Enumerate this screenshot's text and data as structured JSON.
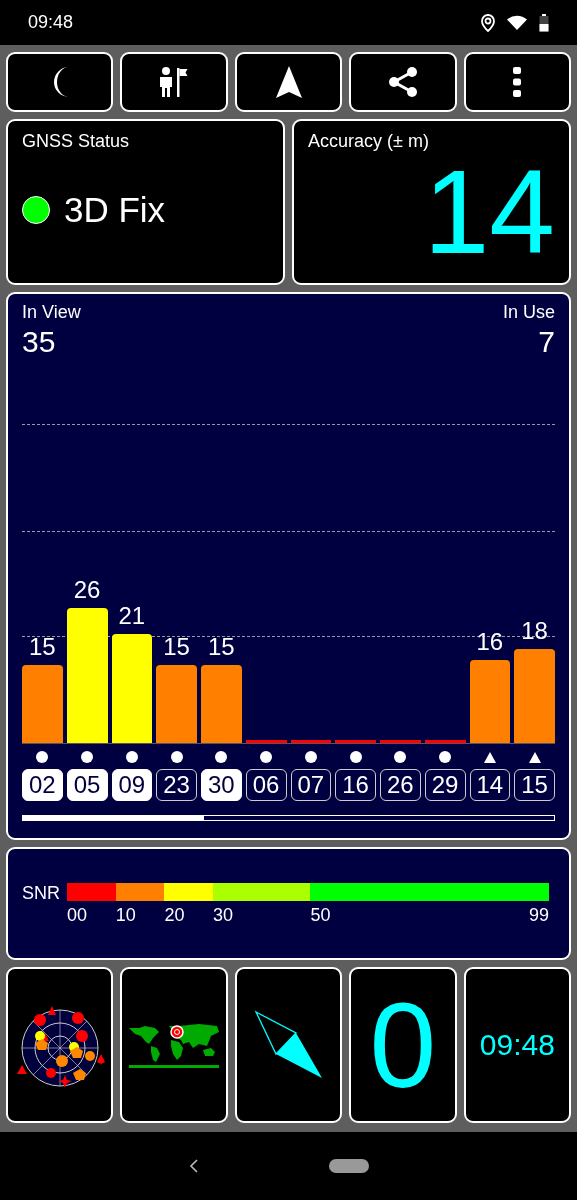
{
  "status_bar": {
    "time": "09:48"
  },
  "status_card": {
    "title": "GNSS Status",
    "fix": "3D Fix",
    "color": "#00ff00"
  },
  "accuracy_card": {
    "title": "Accuracy (± m)",
    "value": "14"
  },
  "satellites_panel": {
    "in_view_label": "In View",
    "in_view": "35",
    "in_use_label": "In Use",
    "in_use": "7",
    "satellites": [
      {
        "id": "02",
        "snr": "15",
        "color": "#ff8000",
        "in_use": true,
        "kind": "circle"
      },
      {
        "id": "05",
        "snr": "26",
        "color": "#ffff00",
        "in_use": true,
        "kind": "circle"
      },
      {
        "id": "09",
        "snr": "21",
        "color": "#ffff00",
        "in_use": true,
        "kind": "circle"
      },
      {
        "id": "23",
        "snr": "15",
        "color": "#ff8000",
        "in_use": false,
        "kind": "circle"
      },
      {
        "id": "30",
        "snr": "15",
        "color": "#ff8000",
        "in_use": true,
        "kind": "circle"
      },
      {
        "id": "06",
        "color": "#ff0000",
        "in_use": false,
        "kind": "circle"
      },
      {
        "id": "07",
        "color": "#ff0000",
        "in_use": false,
        "kind": "circle"
      },
      {
        "id": "16",
        "color": "#ff0000",
        "in_use": false,
        "kind": "circle"
      },
      {
        "id": "26",
        "color": "#ff0000",
        "in_use": false,
        "kind": "circle"
      },
      {
        "id": "29",
        "color": "#ff0000",
        "in_use": false,
        "kind": "circle"
      },
      {
        "id": "14",
        "snr": "16",
        "color": "#ff8000",
        "in_use": false,
        "kind": "triangle"
      },
      {
        "id": "15",
        "snr": "18",
        "color": "#ff8000",
        "in_use": false,
        "kind": "triangle"
      }
    ]
  },
  "snr_legend": {
    "label": "SNR",
    "segments": [
      {
        "label": "00",
        "color": "#ff0000"
      },
      {
        "label": "10",
        "color": "#ff8000"
      },
      {
        "label": "20",
        "color": "#ffff00"
      },
      {
        "label": "30",
        "color": "#aaff00"
      },
      {
        "label": "50",
        "color": "#00ff00"
      }
    ],
    "end_label": "99"
  },
  "bottom_tiles": {
    "speed": "0",
    "clock": "09:48"
  }
}
